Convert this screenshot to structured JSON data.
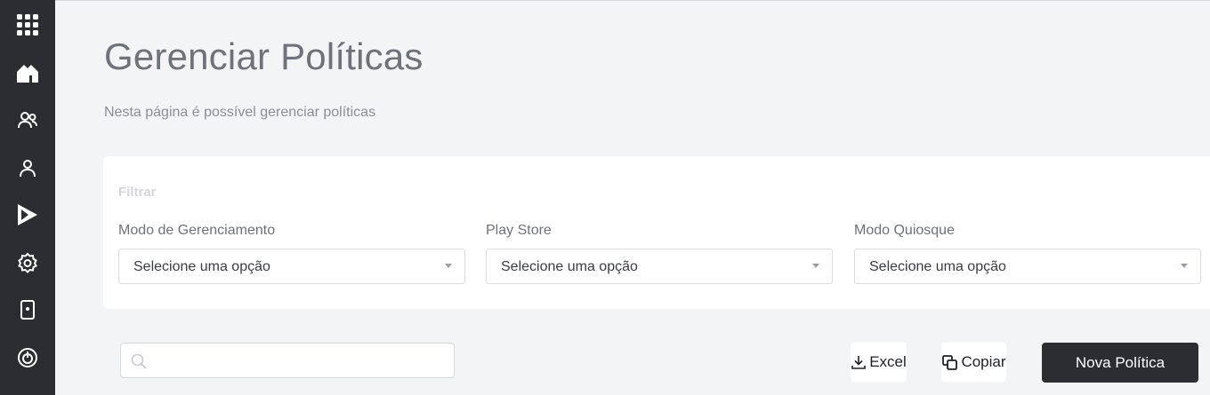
{
  "sidebar": {
    "items": [
      {
        "icon": "apps-grid-icon"
      },
      {
        "icon": "home-icon"
      },
      {
        "icon": "users-icon"
      },
      {
        "icon": "user-icon"
      },
      {
        "icon": "play-store-icon"
      },
      {
        "icon": "settings-icon"
      },
      {
        "icon": "device-icon"
      },
      {
        "icon": "power-icon"
      }
    ]
  },
  "header": {
    "title": "Gerenciar Políticas",
    "subtitle": "Nesta página é possível gerenciar políticas"
  },
  "filter": {
    "title": "Filtrar",
    "fields": [
      {
        "label": "Modo de Gerenciamento",
        "value": "Selecione uma opção"
      },
      {
        "label": "Play Store",
        "value": "Selecione uma opção"
      },
      {
        "label": "Modo Quiosque",
        "value": "Selecione uma opção"
      }
    ]
  },
  "toolbar": {
    "search_placeholder": "",
    "excel_label": "Excel",
    "copy_label": "Copiar",
    "new_policy_label": "Nova Política"
  },
  "colors": {
    "sidebar_bg": "#2b2d33",
    "page_bg": "#f3f4f6",
    "primary_button": "#2b2d33"
  }
}
